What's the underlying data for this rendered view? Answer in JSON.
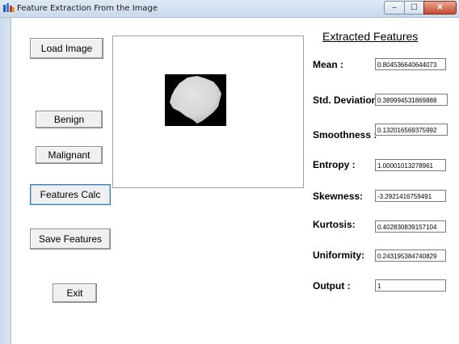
{
  "window": {
    "title": "Feature Extraction From the Image"
  },
  "controls": {
    "minimize": "–",
    "maximize": "☐",
    "close": "✕"
  },
  "buttons": {
    "load_image": "Load Image",
    "benign": "Benign",
    "malignant": "Malignant",
    "features_calc": "Features Calc",
    "save_features": "Save Features",
    "exit": "Exit"
  },
  "features": {
    "title": "Extracted Features",
    "items": [
      {
        "label": "Mean :",
        "value": "0.804536640644073"
      },
      {
        "label": "Std. Deviation :",
        "value": "0.389994531869888"
      },
      {
        "label": "Smoothness :",
        "value": "0.132016569375992"
      },
      {
        "label": "Entropy :",
        "value": "1.00001013278961"
      },
      {
        "label": "Skewness:",
        "value": "-3.2921416759491"
      },
      {
        "label": "Kurtosis:",
        "value": "0.402830839157104"
      },
      {
        "label": "Uniformity:",
        "value": "0.243195384740829"
      },
      {
        "label": "Output :",
        "value": "1"
      }
    ]
  },
  "colors": {
    "close_button": "#c74a30",
    "titlebar": "#dfe9f5"
  },
  "icons": {
    "app": "app-icon"
  }
}
